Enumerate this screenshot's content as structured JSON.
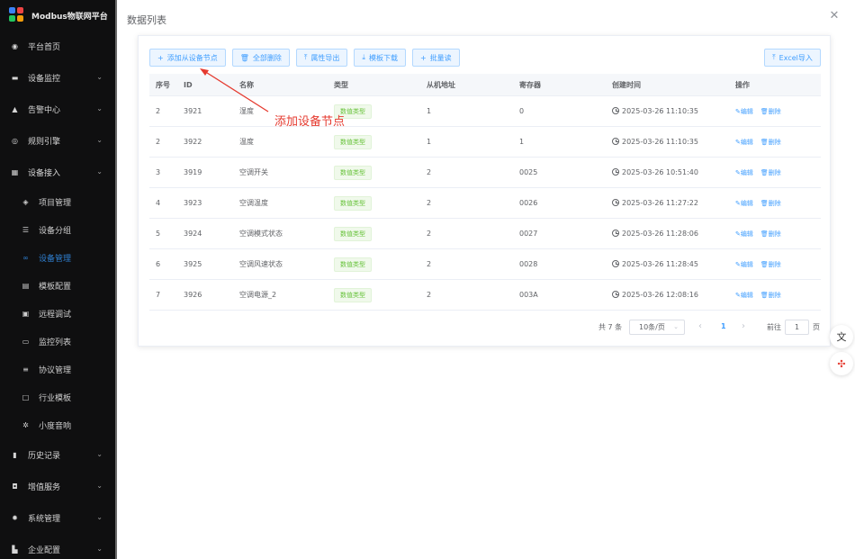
{
  "brand": {
    "title": "Modbus物联网平台"
  },
  "sidebar": {
    "items": [
      {
        "label": "平台首页",
        "icon": "dashboard-icon",
        "glyph": "◉",
        "chevron": false
      },
      {
        "label": "设备监控",
        "icon": "monitor-icon",
        "glyph": "▬",
        "chevron": true
      },
      {
        "label": "告警中心",
        "icon": "bell-icon",
        "glyph": "▲",
        "chevron": true
      },
      {
        "label": "规则引擎",
        "icon": "compass-icon",
        "glyph": "◎",
        "chevron": true
      },
      {
        "label": "设备接入",
        "icon": "grid-icon",
        "glyph": "▦",
        "chevron": true
      }
    ],
    "subitems": [
      {
        "label": "项目管理",
        "icon": "layers-icon",
        "glyph": "◈",
        "active": false
      },
      {
        "label": "设备分组",
        "icon": "group-icon",
        "glyph": "☰",
        "active": false
      },
      {
        "label": "设备管理",
        "icon": "link-icon",
        "glyph": "∞",
        "active": true
      },
      {
        "label": "模板配置",
        "icon": "template-icon",
        "glyph": "▤",
        "active": false
      },
      {
        "label": "远程调试",
        "icon": "debug-icon",
        "glyph": "▣",
        "active": false
      },
      {
        "label": "监控列表",
        "icon": "camera-icon",
        "glyph": "▭",
        "active": false
      },
      {
        "label": "协议管理",
        "icon": "list-icon",
        "glyph": "≡",
        "active": false
      },
      {
        "label": "行业模板",
        "icon": "board-icon",
        "glyph": "□",
        "active": false
      },
      {
        "label": "小度音响",
        "icon": "speaker-icon",
        "glyph": "✲",
        "active": false
      }
    ],
    "bottom_items": [
      {
        "label": "历史记录",
        "icon": "chart-icon",
        "glyph": "▮",
        "chevron": true
      },
      {
        "label": "增值服务",
        "icon": "gift-icon",
        "glyph": "◘",
        "chevron": true
      },
      {
        "label": "系统管理",
        "icon": "settings-icon",
        "glyph": "✹",
        "chevron": true
      },
      {
        "label": "企业配置",
        "icon": "building-icon",
        "glyph": "▙",
        "chevron": true
      }
    ]
  },
  "dialog": {
    "title": "数据列表",
    "close_glyph": "✕"
  },
  "toolbar": {
    "buttons": [
      {
        "label": "添加从设备节点",
        "glyph": "+",
        "name": "add-slave-node-button",
        "icon": "plus-icon"
      },
      {
        "label": "全部删除",
        "glyph": "🗑",
        "name": "delete-all-button",
        "icon": "trash-icon"
      },
      {
        "label": "属性导出",
        "glyph": "⤒",
        "name": "export-attributes-button",
        "icon": "upload-icon"
      },
      {
        "label": "模板下载",
        "glyph": "⤓",
        "name": "template-download-button",
        "icon": "download-icon"
      },
      {
        "label": "批量读",
        "glyph": "+",
        "name": "batch-read-button",
        "icon": "plus-icon"
      }
    ],
    "excel_import": {
      "label": "Excel导入",
      "glyph": "⤒"
    }
  },
  "table": {
    "headers": [
      "序号",
      "ID",
      "名称",
      "类型",
      "从机地址",
      "寄存器",
      "创建时间",
      "操作"
    ],
    "rows": [
      {
        "idx": "2",
        "id": "3921",
        "name": "湿度",
        "type": "数值类型",
        "slave": "1",
        "reg": "0",
        "time": "2025-03-26 11:10:35"
      },
      {
        "idx": "2",
        "id": "3922",
        "name": "温度",
        "type": "数值类型",
        "slave": "1",
        "reg": "1",
        "time": "2025-03-26 11:10:35"
      },
      {
        "idx": "3",
        "id": "3919",
        "name": "空调开关",
        "type": "数值类型",
        "slave": "2",
        "reg": "0025",
        "time": "2025-03-26 10:51:40"
      },
      {
        "idx": "4",
        "id": "3923",
        "name": "空调温度",
        "type": "数值类型",
        "slave": "2",
        "reg": "0026",
        "time": "2025-03-26 11:27:22"
      },
      {
        "idx": "5",
        "id": "3924",
        "name": "空调模式状态",
        "type": "数值类型",
        "slave": "2",
        "reg": "0027",
        "time": "2025-03-26 11:28:06"
      },
      {
        "idx": "6",
        "id": "3925",
        "name": "空调风速状态",
        "type": "数值类型",
        "slave": "2",
        "reg": "0028",
        "time": "2025-03-26 11:28:45"
      },
      {
        "idx": "7",
        "id": "3926",
        "name": "空调电源_2",
        "type": "数值类型",
        "slave": "2",
        "reg": "003A",
        "time": "2025-03-26 12:08:16"
      }
    ],
    "op_edit": "✎编辑",
    "op_delete": "🗑删除"
  },
  "pagination": {
    "total": "共 7 条",
    "page_size": "10条/页",
    "current": "1",
    "goto_label": "前往",
    "goto_value": "1",
    "goto_unit": "页",
    "prev_glyph": "‹",
    "next_glyph": "›",
    "dropdown_glyph": "⌄"
  },
  "annotation": {
    "text": "添加设备节点",
    "color": "#e53a2f"
  },
  "floating": {
    "translate_glyph": "文",
    "plugin_glyph": "✣"
  }
}
